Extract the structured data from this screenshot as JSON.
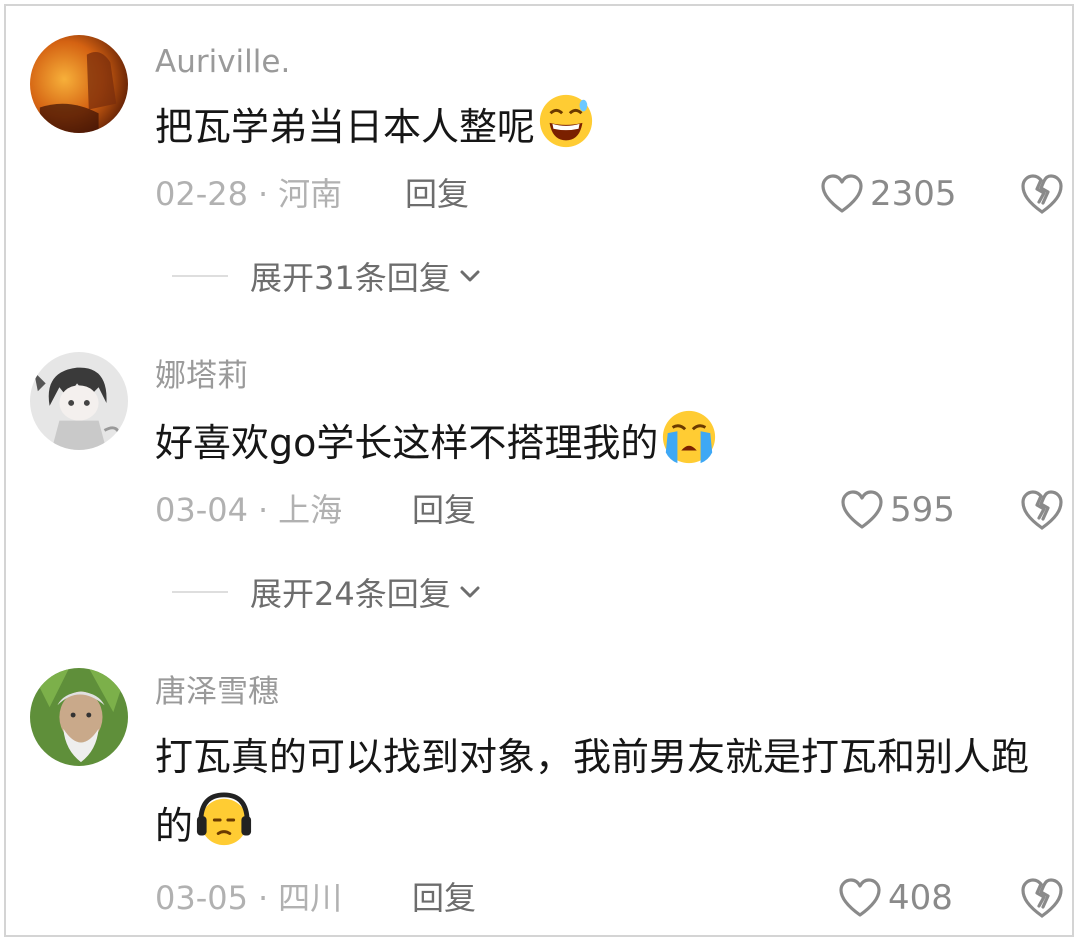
{
  "comments": [
    {
      "username": "Auriville.",
      "text": "把瓦学弟当日本人整呢",
      "emoji": "grinning-sweat-face-icon",
      "date": "02-28",
      "location": "河南",
      "reply_label": "回复",
      "likes": "2305",
      "expand_label": "展开31条回复"
    },
    {
      "username": "娜塔莉",
      "text": "好喜欢go学长这样不搭理我的",
      "emoji": "crying-face-icon",
      "date": "03-04",
      "location": "上海",
      "reply_label": "回复",
      "likes": "595",
      "expand_label": "展开24条回复"
    },
    {
      "username": "唐泽雪穗",
      "text": "打瓦真的可以找到对象，我前男友就是打瓦和别人跑的",
      "emoji": "headphones-face-icon",
      "date": "03-05",
      "location": "四川",
      "reply_label": "回复",
      "likes": "408"
    }
  ],
  "separator": "·",
  "colors": {
    "username": "#9a9a9a",
    "text": "#161616",
    "meta": "#b1b1b1",
    "action": "#6d6d6d"
  }
}
